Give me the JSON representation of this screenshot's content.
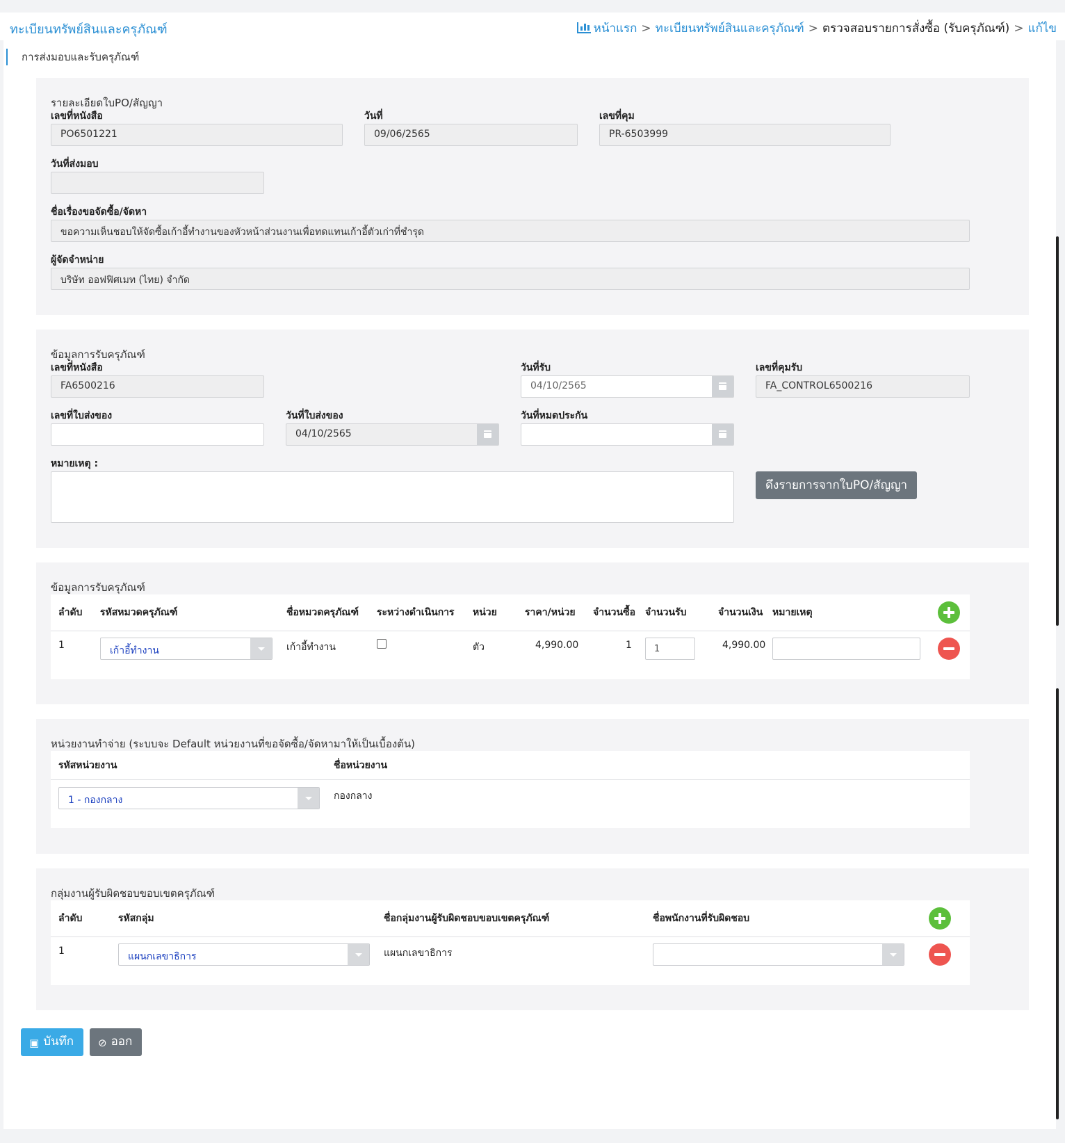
{
  "header": {
    "app_title": "ทะเบียนทรัพย์สินและครุภัณฑ์",
    "breadcrumb": {
      "home": "หน้าแรก",
      "sep": ">",
      "registry": "ทะเบียนทรัพย์สินและครุภัณฑ์",
      "check": "ตรวจสอบรายการสั่งซื้อ (รับครุภัณฑ์)",
      "edit": "แก้ไข"
    }
  },
  "page": {
    "subtitle": "การส่งมอบและรับครุภัณฑ์"
  },
  "po_section": {
    "title": "รายละเอียดใบPO/สัญญา",
    "doc_no_label": "เลขที่หนังสือ",
    "doc_no": "PO6501221",
    "date_label": "วันที่",
    "date": "09/06/2565",
    "control_no_label": "เลขที่คุม",
    "control_no": "PR-6503999",
    "delivery_date_label": "วันที่ส่งมอบ",
    "delivery_date": "",
    "subject_label": "ชื่อเรื่องขอจัดซื้อ/จัดหา",
    "subject": "ขอความเห็นชอบให้จัดซื้อเก้าอี้ทำงานของหัวหน้าส่วนงานเพื่อทดแทนเก้าอี้ตัวเก่าที่ชำรุด",
    "vendor_label": "ผู้จัดจำหน่าย",
    "vendor": "บริษัท ออฟฟิศเมท (ไทย) จำกัด"
  },
  "receive_section": {
    "title": "ข้อมูลการรับครุภัณฑ์",
    "doc_no_label": "เลขที่หนังสือ",
    "doc_no": "FA6500216",
    "receive_date_label": "วันที่รับ",
    "receive_date": "04/10/2565",
    "receive_control_label": "เลขที่คุมรับ",
    "receive_control": "FA_CONTROL6500216",
    "invoice_no_label": "เลขที่ใบส่งของ",
    "invoice_no": "",
    "invoice_date_label": "วันที่ใบส่งของ",
    "invoice_date": "04/10/2565",
    "warranty_label": "วันที่หมดประกัน",
    "warranty": "",
    "remark_label": "หมายเหตุ :",
    "remark": "",
    "pull_button": "ดึงรายการจากใบPO/สัญญา"
  },
  "items_section": {
    "title": "ข้อมูลการรับครุภัณฑ์",
    "headers": [
      "ลำดับ",
      "รหัสหมวดครุภัณฑ์",
      "ชื่อหมวดครุภัณฑ์",
      "ระหว่างดำเนินการ",
      "หน่วย",
      "ราคา/หน่วย",
      "จำนวนซื้อ",
      "จำนวนรับ",
      "จำนวนเงิน",
      "หมายเหตุ"
    ],
    "rows": [
      {
        "no": "1",
        "category_code": "เก้าอี้ทำงาน",
        "category_name": "เก้าอี้ทำงาน",
        "in_progress": false,
        "unit": "ตัว",
        "price": "4,990.00",
        "qty_buy": "1",
        "qty_receive": "1",
        "amount": "4,990.00",
        "remark": ""
      }
    ]
  },
  "dept_section": {
    "title": "หน่วยงานทำจ่าย (ระบบจะ Default หน่วยงานที่ขอจัดซื้อ/จัดหามาให้เป็นเบื้องต้น)",
    "headers": [
      "รหัสหน่วยงาน",
      "ชื่อหน่วยงาน"
    ],
    "row": {
      "code": "1 - กองกลาง",
      "name": "กองกลาง"
    }
  },
  "group_section": {
    "title": "กลุ่มงานผู้รับผิดชอบขอบเขตครุภัณฑ์",
    "headers": [
      "ลำดับ",
      "รหัสกลุ่ม",
      "ชื่อกลุ่มงานผู้รับผิดชอบขอบเขตครุภัณฑ์",
      "ชื่อพนักงานที่รับผิดชอบ"
    ],
    "rows": [
      {
        "no": "1",
        "group_code": "แผนกเลขาธิการ",
        "group_name": "แผนกเลขาธิการ",
        "staff": ""
      }
    ]
  },
  "footer": {
    "save": "บันทึก",
    "exit": "ออก"
  }
}
